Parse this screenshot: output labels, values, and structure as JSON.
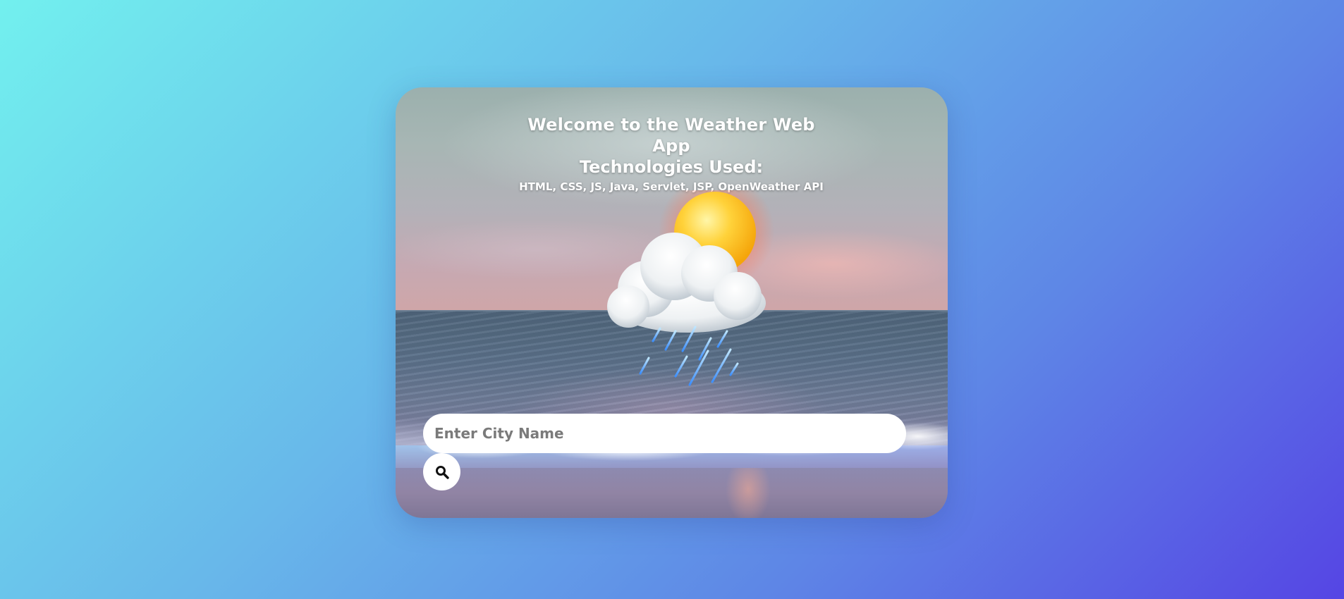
{
  "header": {
    "title": "Welcome to the Weather Web App",
    "subtitle": "Technologies Used:",
    "technologies": "HTML, CSS, JS, Java, Servlet, JSP, OpenWeather API"
  },
  "graphic": {
    "icon": "sun-cloud-rain-icon"
  },
  "search": {
    "placeholder": "Enter City Name",
    "value": "",
    "button_icon": "search-icon"
  },
  "colors": {
    "background_start": "#72f0ee",
    "background_end": "#5545e4",
    "input_background": "#ffffff",
    "sun": "#ffc21a",
    "rain": "#4aa8ff"
  }
}
